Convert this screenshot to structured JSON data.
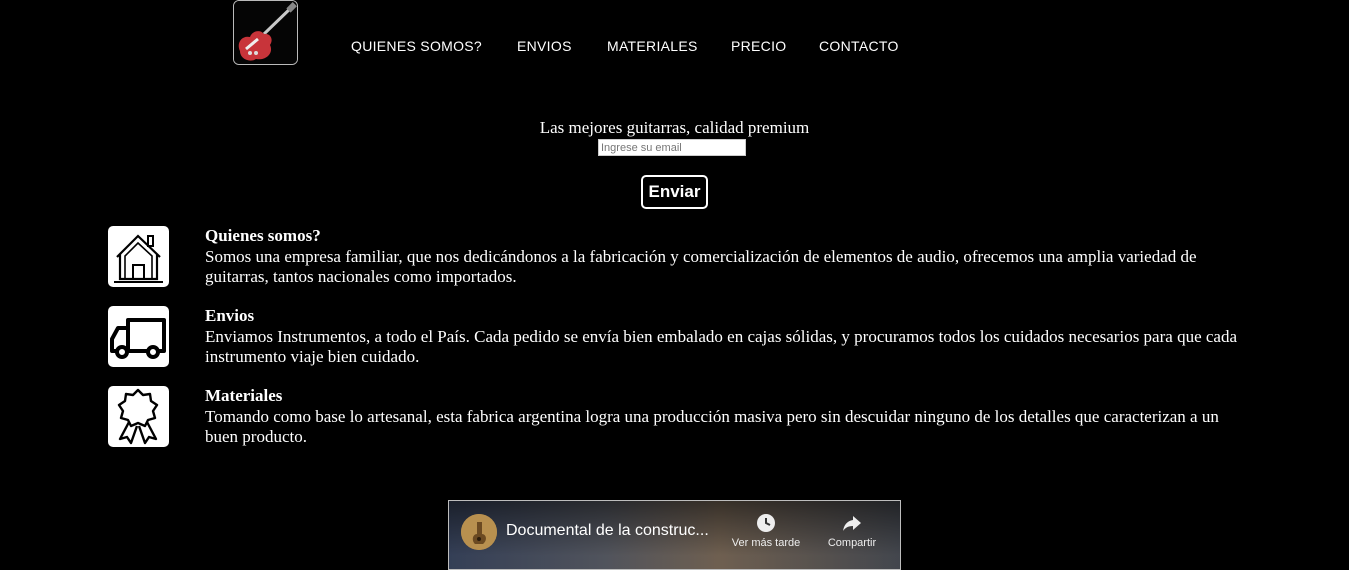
{
  "header": {
    "logo_icon": "electric-guitar-icon",
    "nav": [
      {
        "label": "QUIENES SOMOS?"
      },
      {
        "label": "ENVIOS"
      },
      {
        "label": "MATERIALES"
      },
      {
        "label": "PRECIO"
      },
      {
        "label": "CONTACTO"
      }
    ]
  },
  "hero": {
    "tagline": "Las mejores guitarras, calidad premium",
    "email_placeholder": "Ingrese su email",
    "send_label": "Enviar"
  },
  "features": [
    {
      "icon": "house-icon",
      "title": "Quienes somos?",
      "text": "Somos una empresa familiar, que nos dedicándonos a la fabricación y comercialización de elementos de audio, ofrecemos una amplia variedad de guitarras, tantos nacionales como importados."
    },
    {
      "icon": "truck-icon",
      "title": "Envios",
      "text": "Enviamos Instrumentos, a todo el País. Cada pedido se envía bien embalado en cajas sólidas, y procuramos todos los cuidados necesarios para que cada instrumento viaje bien cuidado."
    },
    {
      "icon": "award-ribbon-icon",
      "title": "Materiales",
      "text": "Tomando como base lo artesanal, esta fabrica argentina logra una producción masiva pero sin descuidar ninguno de los detalles que caracterizan a un buen producto."
    }
  ],
  "video": {
    "title": "Documental de la construc...",
    "watch_later": "Ver más tarde",
    "share": "Compartir"
  }
}
